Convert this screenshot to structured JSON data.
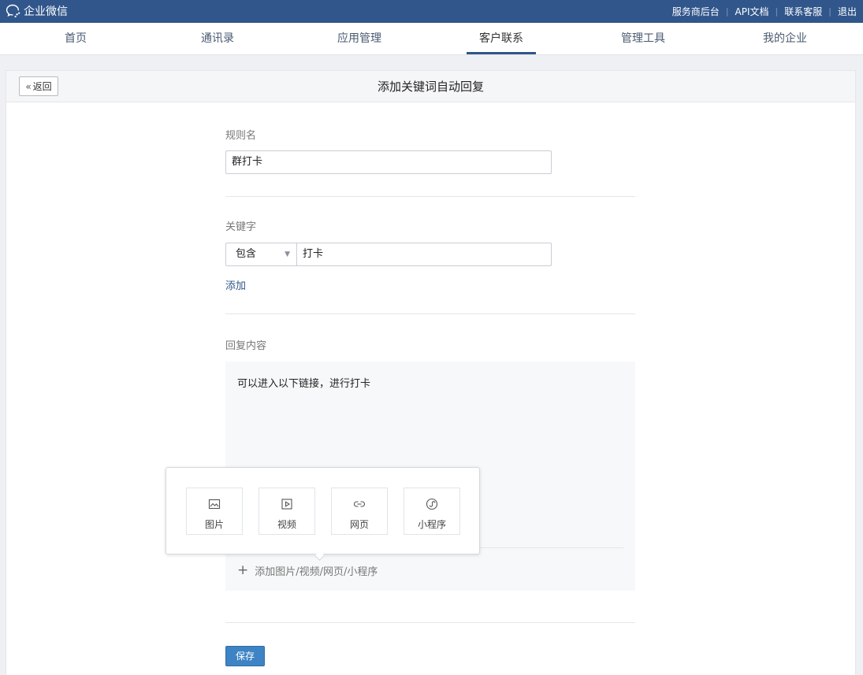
{
  "topbar": {
    "logo_text": "企业微信",
    "links": [
      "服务商后台",
      "API文档",
      "联系客服",
      "退出"
    ]
  },
  "nav": {
    "items": [
      "首页",
      "通讯录",
      "应用管理",
      "客户联系",
      "管理工具",
      "我的企业"
    ],
    "active": "客户联系"
  },
  "card": {
    "back_label": "返回",
    "title": "添加关键词自动回复"
  },
  "form": {
    "rule_name_label": "规则名",
    "rule_name_value": "群打卡",
    "keyword_label": "关键字",
    "keyword_match": "包含",
    "keyword_value": "打卡",
    "add_link": "添加",
    "reply_label": "回复内容",
    "reply_text": "可以进入以下链接，进行打卡",
    "add_attachment": "添加图片/视频/网页/小程序",
    "save_label": "保存"
  },
  "popover": {
    "tiles": [
      {
        "label": "图片",
        "icon": "image-icon"
      },
      {
        "label": "视频",
        "icon": "video-icon"
      },
      {
        "label": "网页",
        "icon": "link-icon"
      },
      {
        "label": "小程序",
        "icon": "miniprogram-icon"
      }
    ]
  },
  "colors": {
    "topbar": "#30568b",
    "accent": "#3e83c4",
    "link": "#30568b"
  }
}
